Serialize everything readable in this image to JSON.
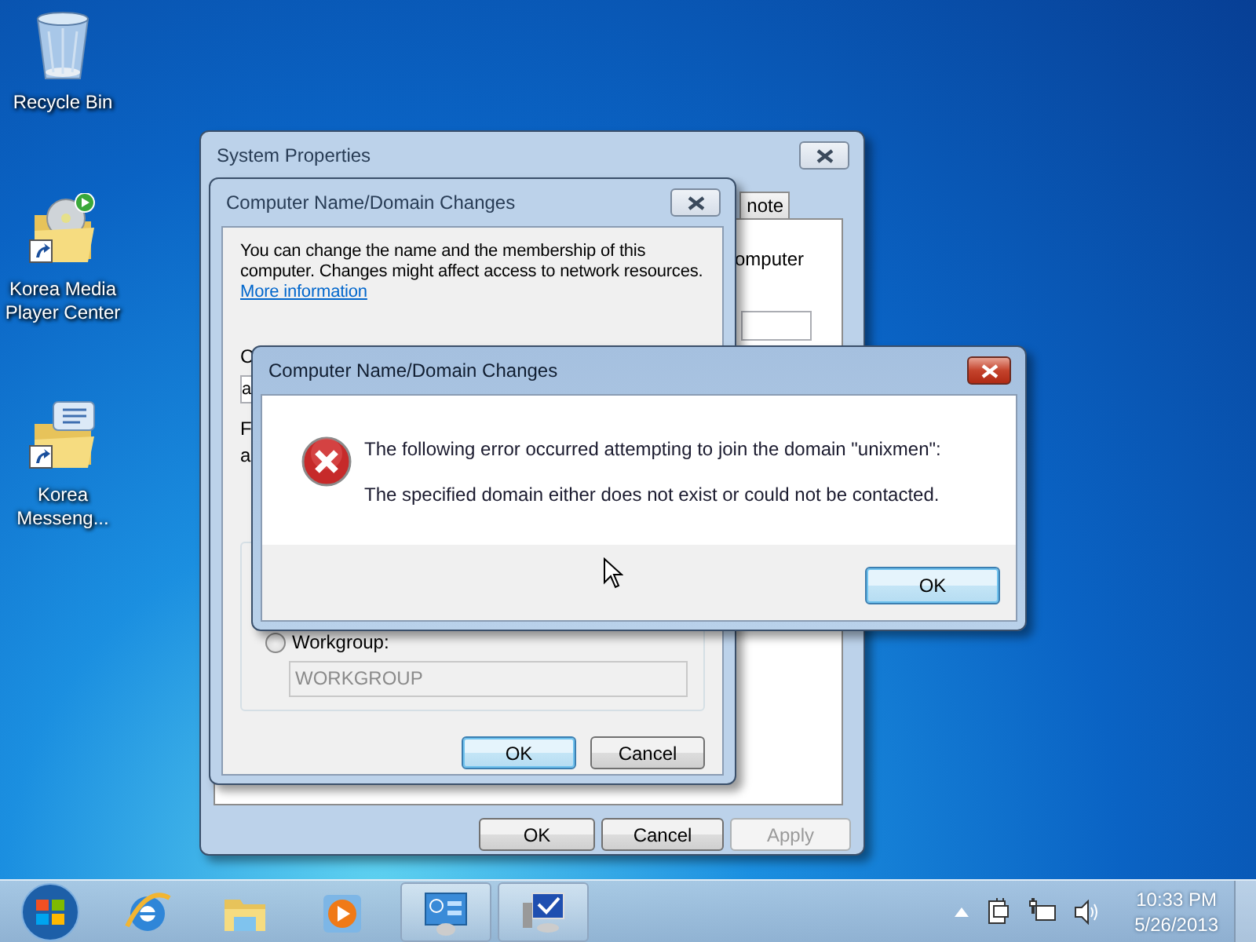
{
  "desktop_icons": [
    {
      "kind": "recycle",
      "label": "Recycle Bin"
    },
    {
      "kind": "media",
      "label": "Korea Media Player Center"
    },
    {
      "kind": "messenger",
      "label": "Korea Messeng..."
    }
  ],
  "system_properties": {
    "title": "System Properties",
    "active": false,
    "tabs": [
      {
        "label": "note",
        "selected": false
      }
    ],
    "panel_text": "omputer",
    "buttons": [
      {
        "label": "OK",
        "disabled": false,
        "default": false
      },
      {
        "label": "Cancel",
        "disabled": false,
        "default": false
      },
      {
        "label": "Apply",
        "disabled": true,
        "default": false
      }
    ]
  },
  "domain_dialog": {
    "title": "Computer Name/Domain Changes",
    "active": false,
    "description": "You can change the name and the membership of this computer. Changes might affect access to network resources.",
    "link": "More information",
    "fragments": [
      "C",
      "a",
      "F",
      "a"
    ],
    "workgroup": {
      "label": "Workgroup:",
      "selected": false,
      "value": "WORKGROUP",
      "disabled": true
    },
    "buttons": [
      {
        "label": "OK",
        "disabled": false,
        "default": true
      },
      {
        "label": "Cancel",
        "disabled": false,
        "default": false
      }
    ]
  },
  "error_dialog": {
    "title": "Computer Name/Domain Changes",
    "active": true,
    "lines": [
      "The following error occurred attempting to join the domain \"unixmen\":",
      "The specified domain either does not exist or could not be contacted."
    ],
    "button": {
      "label": "OK",
      "default": true
    }
  },
  "taskbar": {
    "items": [
      {
        "kind": "ie",
        "active": false
      },
      {
        "kind": "explorer",
        "active": false
      },
      {
        "kind": "player",
        "active": false
      },
      {
        "kind": "control",
        "active": true
      },
      {
        "kind": "system",
        "active": true
      }
    ],
    "clock": {
      "time": "10:33 PM",
      "date": "5/26/2013"
    }
  }
}
